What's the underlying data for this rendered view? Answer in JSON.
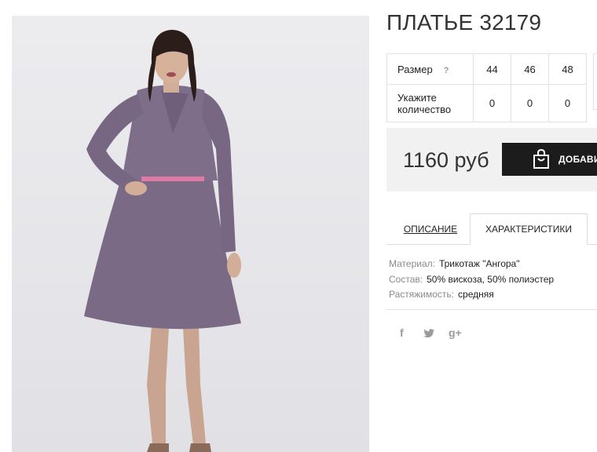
{
  "product": {
    "title": "ПЛАТЬЕ 32179",
    "photo_alt": "dress-photo"
  },
  "size_table": {
    "size_label": "Размер",
    "help_mark": "?",
    "sizes": [
      "44",
      "46",
      "48"
    ],
    "qty_label": "Укажите количество",
    "quantities": [
      "0",
      "0",
      "0"
    ]
  },
  "price": {
    "value": "1160 руб",
    "add_button_label": "ДОБАВИТЬ"
  },
  "tabs": {
    "description": "ОПИСАНИЕ",
    "characteristics": "ХАРАКТЕРИСТИКИ"
  },
  "specs": [
    {
      "key": "Материал:",
      "value": "Трикотаж \"Ангора\""
    },
    {
      "key": "Состав:",
      "value": "50% вискоза, 50% полиэстер"
    },
    {
      "key": "Растяжимость:",
      "value": "средняя"
    }
  ],
  "social": {
    "facebook": "f",
    "twitter": "twitter-icon",
    "google_plus": "g+"
  },
  "colors": {
    "button_bg": "#1c1c1c",
    "price_bg": "#f1f1f1",
    "dress": "#7a6a86",
    "belt": "#e07aa8"
  }
}
